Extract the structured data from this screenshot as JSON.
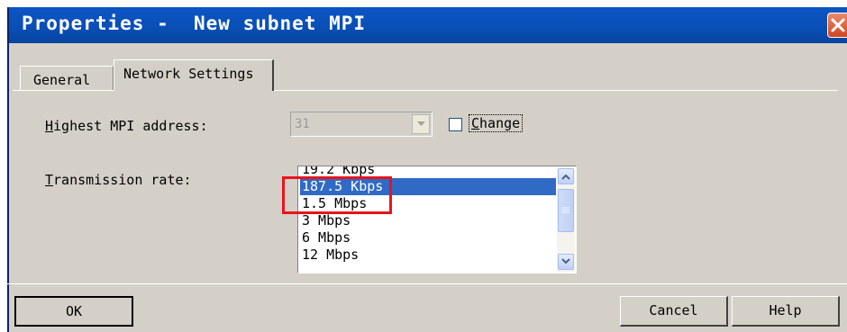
{
  "window": {
    "title": "Properties -  New subnet MPI"
  },
  "tabs": [
    {
      "label": "General",
      "active": false
    },
    {
      "label": "Network Settings",
      "active": true
    }
  ],
  "highest_mpi": {
    "label_accel": "H",
    "label_rest": "ighest MPI address:",
    "value": "31",
    "disabled": true,
    "change_checkbox": {
      "label_accel": "C",
      "label_rest": "hange",
      "checked": false
    }
  },
  "transmission": {
    "label_accel": "T",
    "label_rest": "ransmission rate:",
    "options": [
      "19.2 Kbps",
      "187.5 Kbps",
      "1.5 Mbps",
      "3 Mbps",
      "6 Mbps",
      "12 Mbps"
    ],
    "selected": "187.5 Kbps"
  },
  "buttons": {
    "ok": "OK",
    "cancel": "Cancel",
    "help": "Help"
  },
  "colors": {
    "title_bar": "#0a4fb6",
    "selection": "#316ac5",
    "annotation": "#e8141b",
    "dialog_bg": "#d4d0c8"
  },
  "icons": [
    "close-icon",
    "dropdown-arrow-icon",
    "scroll-up-arrow-icon",
    "scroll-down-arrow-icon",
    "scroll-thumb-grip-icon"
  ]
}
